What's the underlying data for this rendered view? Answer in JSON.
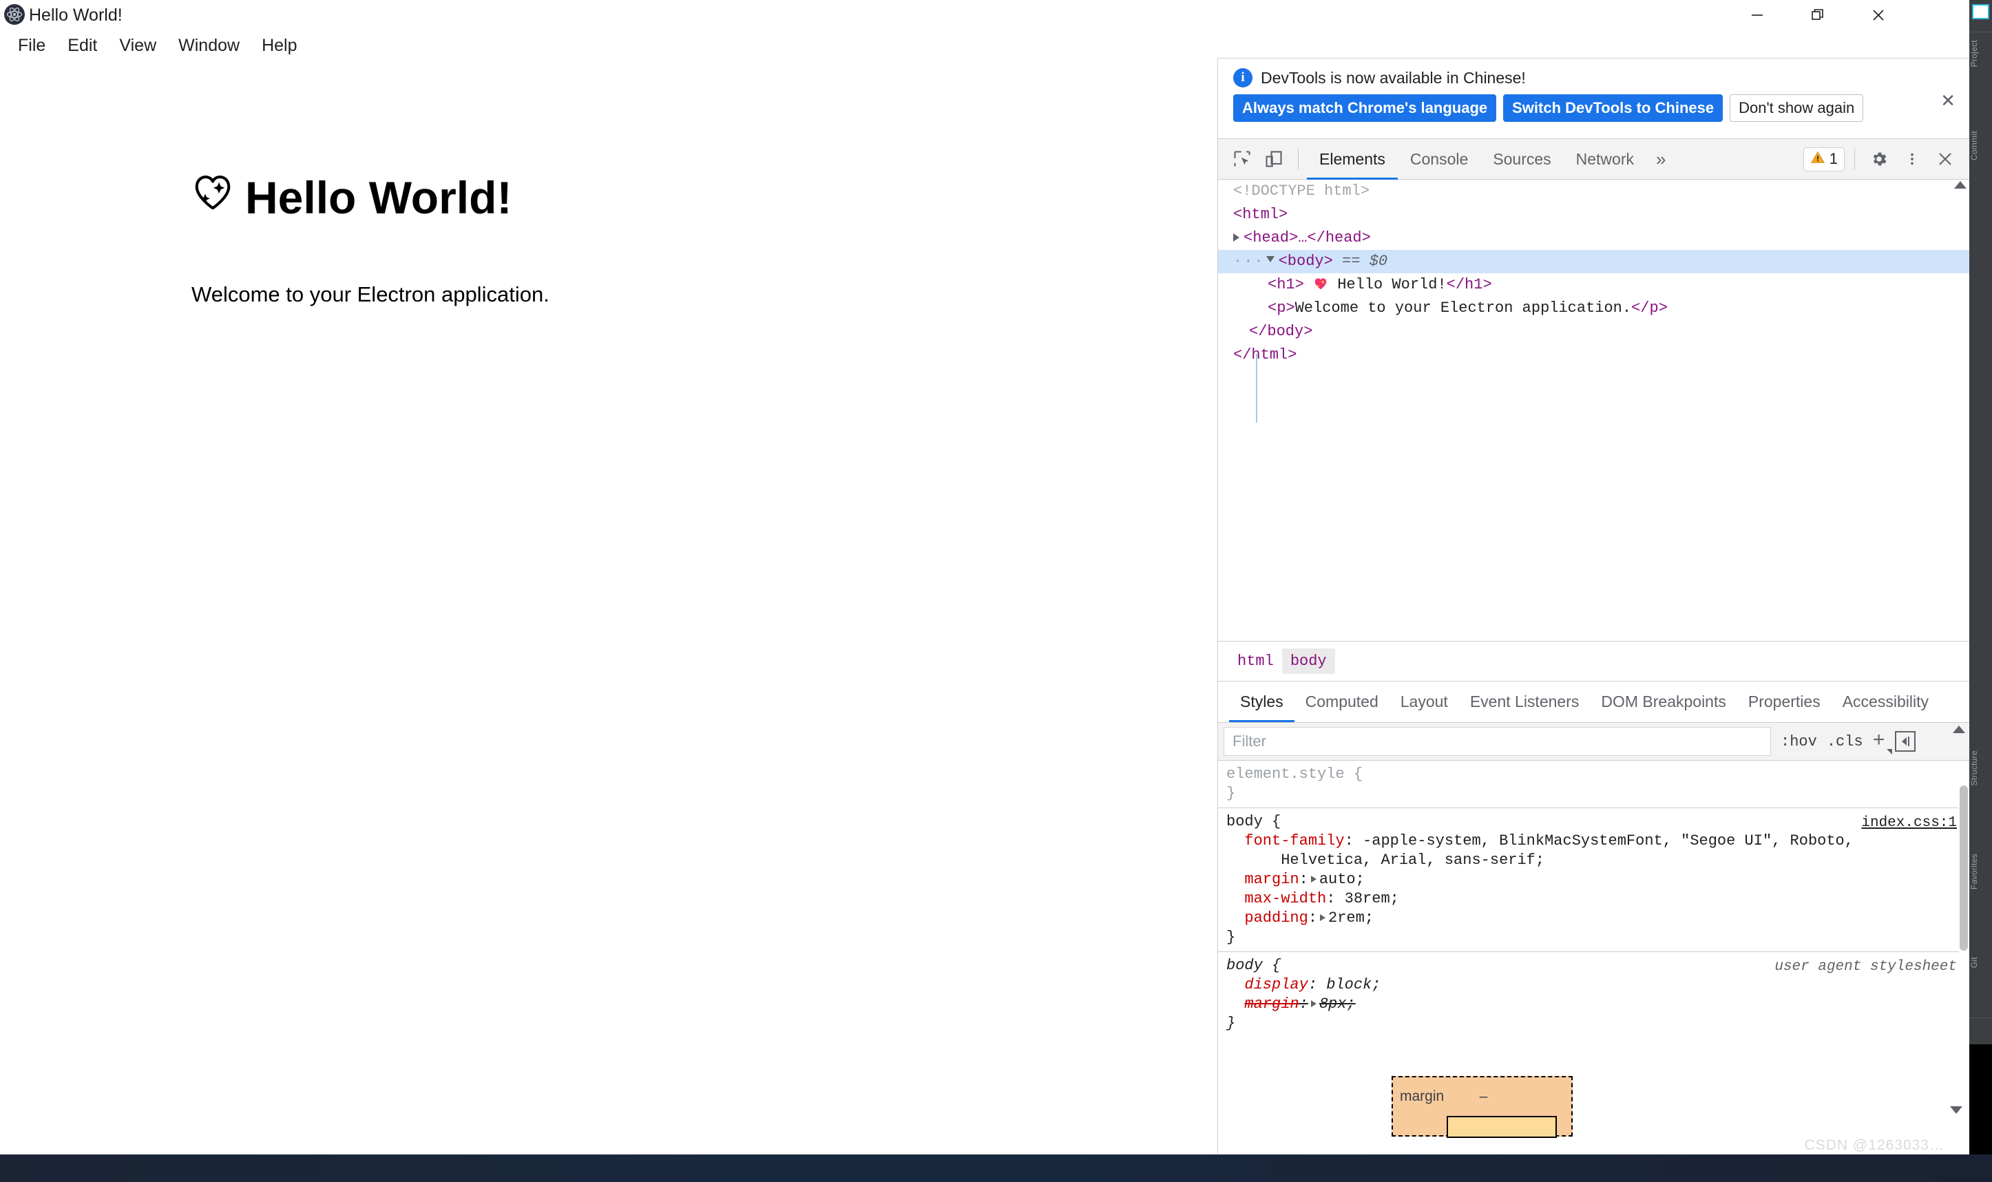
{
  "window": {
    "title": "Hello World!",
    "app_icon": "electron-atom-icon",
    "controls": {
      "minimize": "—",
      "maximize": "restore-icon",
      "close": "✕"
    }
  },
  "menubar": {
    "items": [
      "File",
      "Edit",
      "View",
      "Window",
      "Help"
    ]
  },
  "app": {
    "heading_emoji": "💖",
    "heading": "Hello World!",
    "paragraph": "Welcome to your Electron application."
  },
  "devtools": {
    "notification": {
      "info_icon": "i",
      "message": "DevTools is now available in Chinese!",
      "buttons": [
        {
          "label": "Always match Chrome's language",
          "style": "primary"
        },
        {
          "label": "Switch DevTools to Chinese",
          "style": "primary"
        },
        {
          "label": "Don't show again",
          "style": "plain"
        }
      ],
      "close": "✕"
    },
    "toolbar": {
      "inspect_icon": "inspect-element-icon",
      "device_icon": "device-toolbar-icon",
      "tabs": [
        "Elements",
        "Console",
        "Sources",
        "Network"
      ],
      "active_tab": "Elements",
      "more_tabs": "»",
      "warning_icon": "⚠",
      "warning_count": "1",
      "settings_icon": "gear-icon",
      "more_icon": "kebab-menu-icon",
      "close_icon": "✕"
    },
    "dom": {
      "lines": [
        {
          "id": "doctype",
          "text": "<!DOCTYPE html>"
        },
        {
          "id": "html-open",
          "text": "<html>"
        },
        {
          "id": "head",
          "tag_open": "<head>",
          "ellipsis": "…",
          "tag_close": "</head>"
        },
        {
          "id": "body-open",
          "tag": "<body>",
          "marker": "== $0"
        },
        {
          "id": "h1",
          "open": "<h1>",
          "emoji": "💖",
          "text": " Hello World!",
          "close": "</h1>"
        },
        {
          "id": "p",
          "open": "<p>",
          "text": "Welcome to your Electron application.",
          "close": "</p>"
        },
        {
          "id": "body-close",
          "text": "</body>"
        },
        {
          "id": "html-close",
          "text": "</html>"
        }
      ]
    },
    "breadcrumb": {
      "items": [
        "html",
        "body"
      ],
      "active": "body"
    },
    "style_tabs": {
      "items": [
        "Styles",
        "Computed",
        "Layout",
        "Event Listeners",
        "DOM Breakpoints",
        "Properties",
        "Accessibility"
      ],
      "active": "Styles"
    },
    "filter": {
      "placeholder": "Filter",
      "value": "",
      "hov": ":hov",
      "cls": ".cls",
      "plus": "+",
      "sidebar_toggle_icon": "sidebar-toggle-icon"
    },
    "rules": [
      {
        "selector": "element.style",
        "origin": "",
        "origin_type": "none",
        "declarations": []
      },
      {
        "selector": "body",
        "origin": "index.css:1",
        "origin_type": "link",
        "declarations": [
          {
            "prop": "font-family",
            "value": "-apple-system, BlinkMacSystemFont, \"Segoe UI\", Roboto,",
            "value_cont": "Helvetica, Arial, sans-serif;",
            "expandable": false
          },
          {
            "prop": "margin",
            "value": "auto;",
            "expandable": true
          },
          {
            "prop": "max-width",
            "value": "38rem;",
            "expandable": false
          },
          {
            "prop": "padding",
            "value": "2rem;",
            "expandable": true
          }
        ]
      },
      {
        "selector": "body",
        "origin": "user agent stylesheet",
        "origin_type": "ua",
        "declarations": [
          {
            "prop": "display",
            "value": "block;",
            "expandable": false,
            "struck": false
          },
          {
            "prop": "margin",
            "value": "8px;",
            "expandable": true,
            "struck": true
          }
        ]
      }
    ],
    "box_model": {
      "margin_label": "margin",
      "margin_top_value": "–"
    }
  },
  "ide_strip": {
    "labels": [
      "Project",
      "Commit",
      "Structure",
      "Favorites",
      "Git"
    ]
  },
  "watermark": "CSDN @1263033…",
  "colors": {
    "accent_blue": "#1a73e8",
    "tag_purple": "#881280",
    "prop_red": "#c80000",
    "selected_row": "#cfe4fb",
    "margin_box": "#f8cb9c",
    "border_box": "#fddc9a",
    "warning_yellow": "#f5a623"
  }
}
